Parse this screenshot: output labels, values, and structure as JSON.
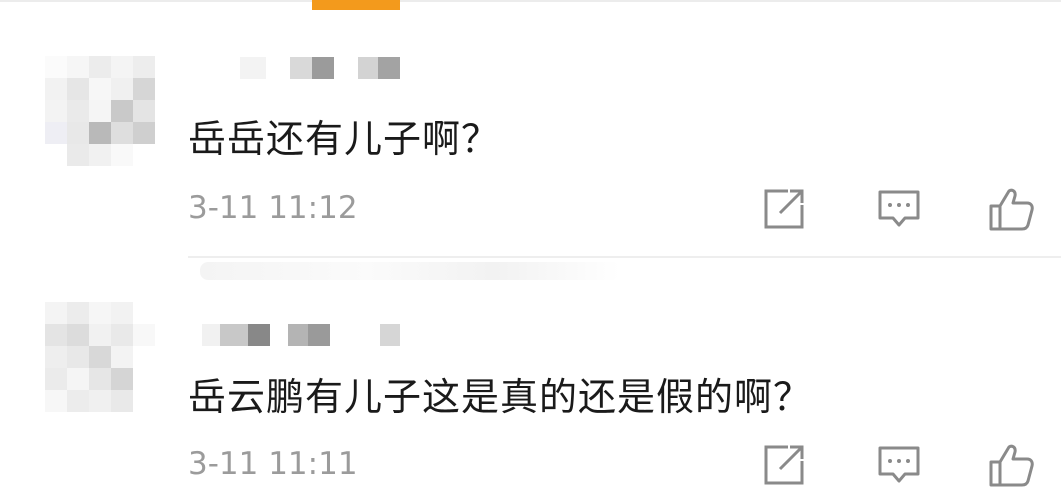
{
  "comments": [
    {
      "text": "岳岳还有儿子啊？",
      "time": "3-11 11:12",
      "actions": {
        "share_icon": "share-external-icon",
        "comment_icon": "comment-bubble-icon",
        "like_icon": "thumbs-up-icon"
      }
    },
    {
      "text": "岳云鹏有儿子这是真的还是假的啊？",
      "time": "3-11 11:11",
      "actions": {
        "share_icon": "share-external-icon",
        "comment_icon": "comment-bubble-icon",
        "like_icon": "thumbs-up-icon"
      }
    }
  ],
  "colors": {
    "accent": "#f39a1c",
    "text": "#1a1a1a",
    "meta": "#9b9b9b",
    "icon": "#8a8a8a"
  }
}
